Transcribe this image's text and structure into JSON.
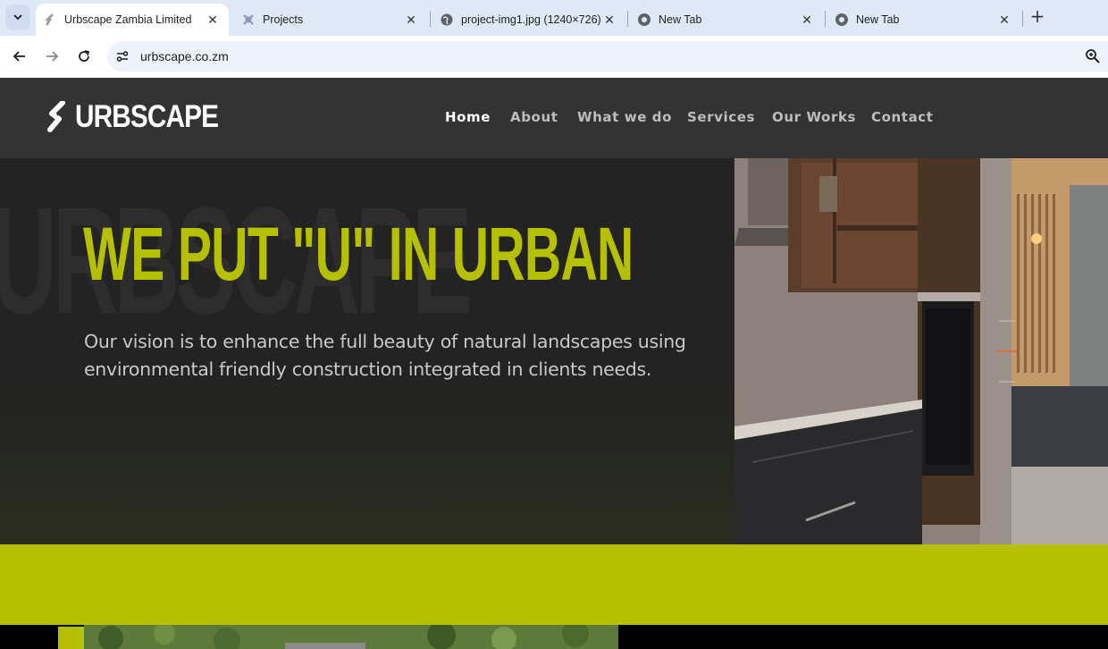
{
  "browser": {
    "tabs": [
      {
        "title": "Urbscape Zambia Limited",
        "active": true,
        "icon": "urbscape-favicon"
      },
      {
        "title": "Projects",
        "active": false,
        "icon": "joomla-icon"
      },
      {
        "title": "project-img1.jpg (1240×726)",
        "active": false,
        "icon": "globe-icon"
      },
      {
        "title": "New Tab",
        "active": false,
        "icon": "chrome-icon"
      },
      {
        "title": "New Tab",
        "active": false,
        "icon": "chrome-icon"
      }
    ],
    "url": "urbscape.co.zm"
  },
  "site": {
    "logo_text": "URBSCAPE",
    "nav": [
      {
        "label": "Home",
        "active": true
      },
      {
        "label": "About",
        "active": false
      },
      {
        "label": "What we do",
        "active": false
      },
      {
        "label": "Services",
        "active": false
      },
      {
        "label": "Our Works",
        "active": false
      },
      {
        "label": "Contact",
        "active": false
      }
    ],
    "hero": {
      "watermark": "URBSCAPE",
      "headline": "WE PUT \"U\" IN URBAN",
      "vision": "Our vision is to enhance the full beauty of natural landscapes using environmental friendly construction integrated in clients needs."
    }
  },
  "colors": {
    "accent": "#b5c000",
    "header_bg": "#333333",
    "hero_bg": "#232323"
  }
}
